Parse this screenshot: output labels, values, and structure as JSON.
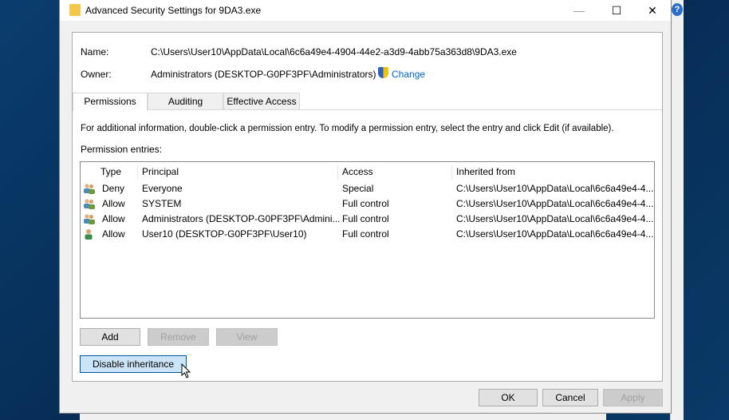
{
  "window": {
    "title": "Advanced Security Settings for 9DA3.exe",
    "minimize": "—",
    "maximize": "☐",
    "close": "✕"
  },
  "name_label": "Name:",
  "name_value": "C:\\Users\\User10\\AppData\\Local\\6c6a49e4-4904-44e2-a3d9-4abb75a363d8\\9DA3.exe",
  "owner_label": "Owner:",
  "owner_value": "Administrators (DESKTOP-G0PF3PF\\Administrators)",
  "change_link": "Change",
  "tabs": [
    {
      "label": "Permissions",
      "active": true
    },
    {
      "label": "Auditing"
    },
    {
      "label": "Effective Access"
    }
  ],
  "info_text": "For additional information, double-click a permission entry. To modify a permission entry, select the entry and click Edit (if available).",
  "entries_label": "Permission entries:",
  "columns": [
    "Type",
    "Principal",
    "Access",
    "Inherited from"
  ],
  "rows": [
    {
      "type": "Deny",
      "principal": "Everyone",
      "access": "Special",
      "inherited": "C:\\Users\\User10\\AppData\\Local\\6c6a49e4-4...",
      "icon": "group-icon"
    },
    {
      "type": "Allow",
      "principal": "SYSTEM",
      "access": "Full control",
      "inherited": "C:\\Users\\User10\\AppData\\Local\\6c6a49e4-4...",
      "icon": "group-icon"
    },
    {
      "type": "Allow",
      "principal": "Administrators (DESKTOP-G0PF3PF\\Admini...",
      "access": "Full control",
      "inherited": "C:\\Users\\User10\\AppData\\Local\\6c6a49e4-4...",
      "icon": "group-icon"
    },
    {
      "type": "Allow",
      "principal": "User10 (DESKTOP-G0PF3PF\\User10)",
      "access": "Full control",
      "inherited": "C:\\Users\\User10\\AppData\\Local\\6c6a49e4-4...",
      "icon": "user-icon"
    }
  ],
  "buttons": {
    "add": "Add",
    "remove": "Remove",
    "view": "View",
    "disable_inheritance": "Disable inheritance",
    "ok": "OK",
    "cancel": "Cancel",
    "apply": "Apply"
  },
  "help": "?",
  "colors": {
    "link": "#0066cc",
    "hover_button": "#cce4f7"
  }
}
